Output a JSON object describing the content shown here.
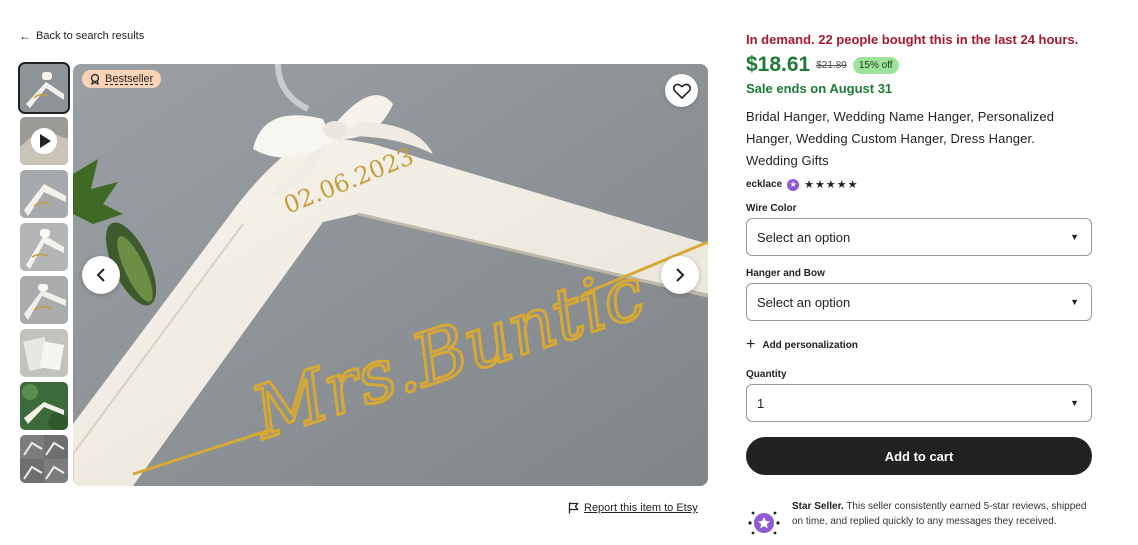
{
  "nav": {
    "back_label": "Back to search results"
  },
  "gallery": {
    "bestseller_label": "Bestseller",
    "report_label": "Report this item to Etsy",
    "main_text": {
      "date": "02.06.2023",
      "name": "Mrs.Buntic"
    },
    "thumbnails": [
      "thumb-1",
      "thumb-2-video",
      "thumb-3",
      "thumb-4",
      "thumb-5",
      "thumb-6",
      "thumb-7",
      "thumb-8"
    ]
  },
  "product": {
    "demand": "In demand. 22 people bought this in the last 24 hours.",
    "price": "$18.61",
    "old_price": "$21.89",
    "discount": "15% off",
    "sale_ends": "Sale ends on August 31",
    "title": "Bridal Hanger, Wedding Name Hanger, Personalized Hanger, Wedding Custom Hanger, Dress Hanger. Wedding Gifts",
    "seller": "ecklace",
    "stars": "★★★★★",
    "rating": 5
  },
  "options": {
    "wire_color": {
      "label": "Wire Color",
      "value": "Select an option"
    },
    "hanger_bow": {
      "label": "Hanger and Bow",
      "value": "Select an option"
    },
    "personalization_label": "Add personalization",
    "quantity": {
      "label": "Quantity",
      "value": "1"
    }
  },
  "cart": {
    "add_label": "Add to cart"
  },
  "star_seller": {
    "title": "Star Seller.",
    "text": "This seller consistently earned 5-star reviews, shipped on time, and replied quickly to any messages they received."
  },
  "colors": {
    "demand": "#a61a2e",
    "price": "#1d7a37",
    "discount_bg": "#9ee29b",
    "bestseller_bg": "#fdd3b5",
    "button_bg": "#222222",
    "star_seller": "#8f5ad6"
  }
}
